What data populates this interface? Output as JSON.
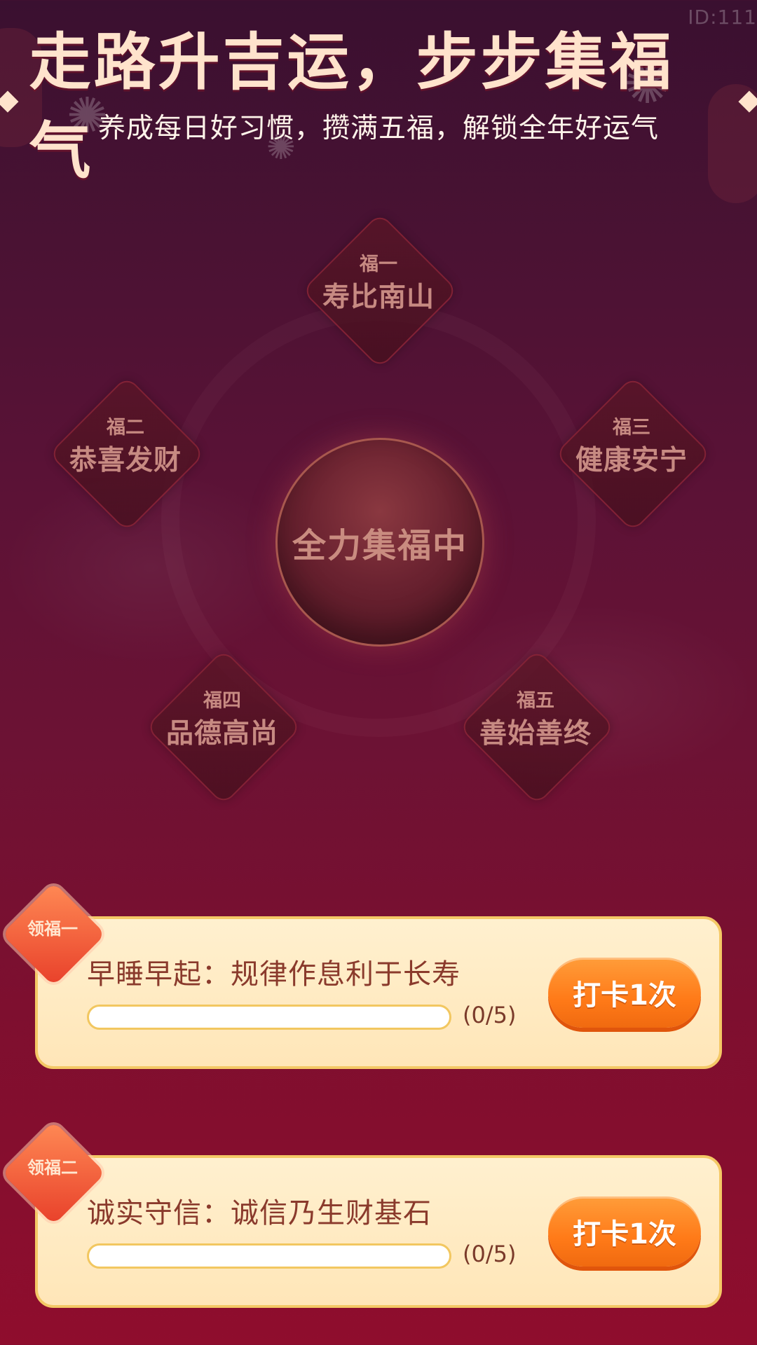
{
  "corner_id": "ID:111",
  "header": {
    "title": "走路升吉运，步步集福气",
    "subtitle": "养成每日好习惯，攒满五福，解锁全年好运气"
  },
  "blessings": [
    {
      "label": "福一",
      "name": "寿比南山"
    },
    {
      "label": "福二",
      "name": "恭喜发财"
    },
    {
      "label": "福三",
      "name": "健康安宁"
    },
    {
      "label": "福四",
      "name": "品德高尚"
    },
    {
      "label": "福五",
      "name": "善始善终"
    }
  ],
  "center_status": "全力集福中",
  "tasks": [
    {
      "badge": "领福一",
      "text": "早睡早起：规律作息利于长寿",
      "progress_current": 0,
      "progress_total": 5,
      "progress_text": "(0/5)",
      "button": "打卡1次"
    },
    {
      "badge": "领福二",
      "text": "诚实守信：诚信乃生财基石",
      "progress_current": 0,
      "progress_total": 5,
      "progress_text": "(0/5)",
      "button": "打卡1次"
    }
  ],
  "colors": {
    "title": "#ffe3cc",
    "button": "#ff8a20",
    "card": "#ffeccb"
  }
}
